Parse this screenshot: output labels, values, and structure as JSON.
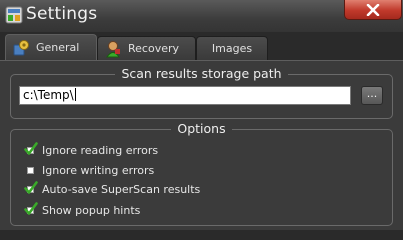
{
  "window": {
    "title": "Settings",
    "close_glyph": "close-icon"
  },
  "tabs": [
    {
      "label": "General",
      "icon": "gear-cube-icon",
      "active": true
    },
    {
      "label": "Recovery",
      "icon": "recovery-figure-icon",
      "active": false
    },
    {
      "label": "Images",
      "icon": "",
      "active": false
    }
  ],
  "storage": {
    "group_title": "Scan results storage path",
    "path_value": "c:\\Temp\\",
    "browse_label": "..."
  },
  "options": {
    "group_title": "Options",
    "items": [
      {
        "label": "Ignore reading errors",
        "checked": true
      },
      {
        "label": "Ignore writing errors",
        "checked": false
      },
      {
        "label": "Auto-save SuperScan results",
        "checked": true
      },
      {
        "label": "Show popup hints",
        "checked": true
      }
    ]
  },
  "colors": {
    "check_green": "#3aaa2a",
    "close_red": "#c0392b",
    "panel_bg": "#3b3b3b"
  }
}
